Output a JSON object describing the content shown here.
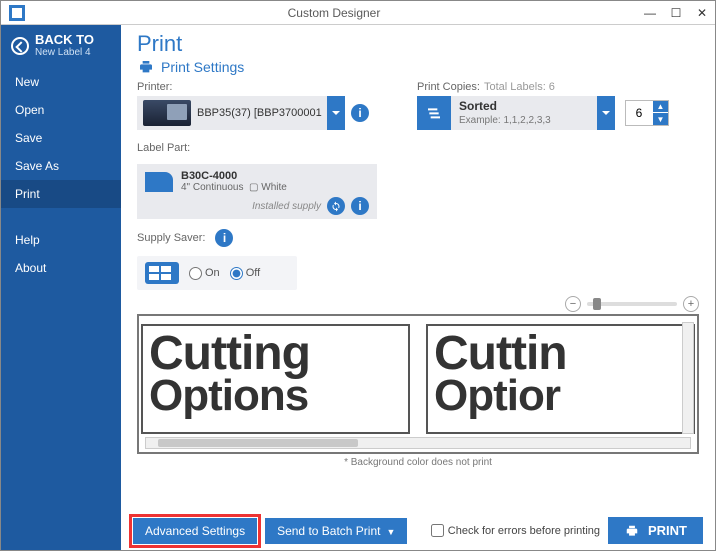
{
  "titlebar": {
    "app_name": "Custom Designer"
  },
  "sidebar": {
    "back_title": "BACK TO",
    "back_subtitle": "New Label 4",
    "items": [
      "New",
      "Open",
      "Save",
      "Save As",
      "Print"
    ],
    "active_index": 4,
    "footer_items": [
      "Help",
      "About"
    ]
  },
  "page": {
    "title": "Print",
    "subtitle": "Print Settings"
  },
  "printer": {
    "section_label": "Printer:",
    "name": "BBP35(37) [BBP3700001"
  },
  "copies": {
    "section_label": "Print Copies:",
    "total_label": "Total Labels: 6",
    "mode": "Sorted",
    "example": "Example: 1,1,2,2,3,3",
    "value": "6"
  },
  "labelpart": {
    "section_label": "Label Part:",
    "part_no": "B30C-4000",
    "width": "4\" Continuous",
    "color": "White",
    "installed": "Installed supply"
  },
  "supply": {
    "section_label": "Supply Saver:",
    "on": "On",
    "off": "Off"
  },
  "preview": {
    "line1": "Cutting",
    "line2": "Options",
    "line1b": "Cuttin",
    "line2b": "Optior",
    "note": "* Background color does not print"
  },
  "footer": {
    "advanced": "Advanced Settings",
    "batch": "Send to Batch Print",
    "check_errors": "Check for errors before printing",
    "print": "PRINT"
  }
}
